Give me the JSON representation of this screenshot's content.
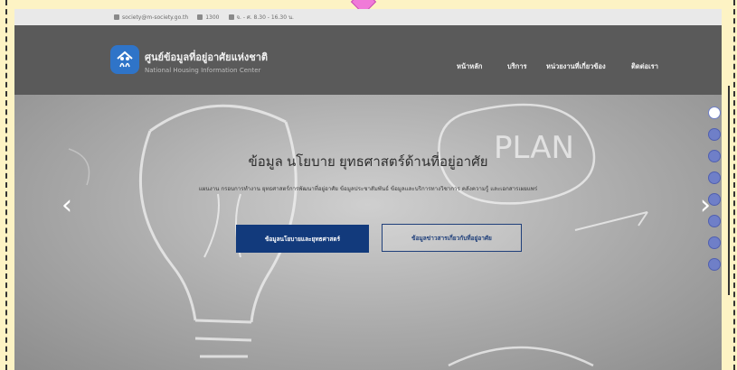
{
  "topbar": {
    "email": "society@m-society.go.th",
    "phone": "1300",
    "hours": "จ. - ศ. 8.30 - 16.30 น."
  },
  "brand": {
    "name_th": "ศูนย์ข้อมูลที่อยู่อาศัยแห่งชาติ",
    "name_en": "National Housing Information Center"
  },
  "nav": [
    {
      "label": "หน้าหลัก"
    },
    {
      "label": "บริการ"
    },
    {
      "label": "หน่วยงานที่เกี่ยวข้อง"
    },
    {
      "label": "ติดต่อเรา"
    }
  ],
  "hero": {
    "title": "ข้อมูล นโยบาย ยุทธศาสตร์ด้านที่อยู่อาศัย",
    "subtitle": "แผนงาน กรอบการทำงาน ยุทธศาสตร์การพัฒนาที่อยู่อาศัย ข้อมูลประชาสัมพันธ์ ข้อมูลและบริการทางวิชาการ คลังความรู้ และเอกสารเผยแพร่",
    "primary_button": "ข้อมูลนโยบายและยุทธศาสตร์",
    "secondary_button": "ข้อมูลข่าวสารเกี่ยวกับที่อยู่อาศัย",
    "chalk_word": "PLAN"
  },
  "carousel": {
    "prev_icon": "chevron-left-icon",
    "next_icon": "chevron-right-icon",
    "slide_count": 8,
    "active_index": 0
  },
  "colors": {
    "header_bg": "#5a5a5a",
    "primary_button_bg": "#123a7c",
    "logo_blue": "#2f74c8",
    "dot_color": "#6f7fc8",
    "page_bg": "#fdf3c4"
  }
}
